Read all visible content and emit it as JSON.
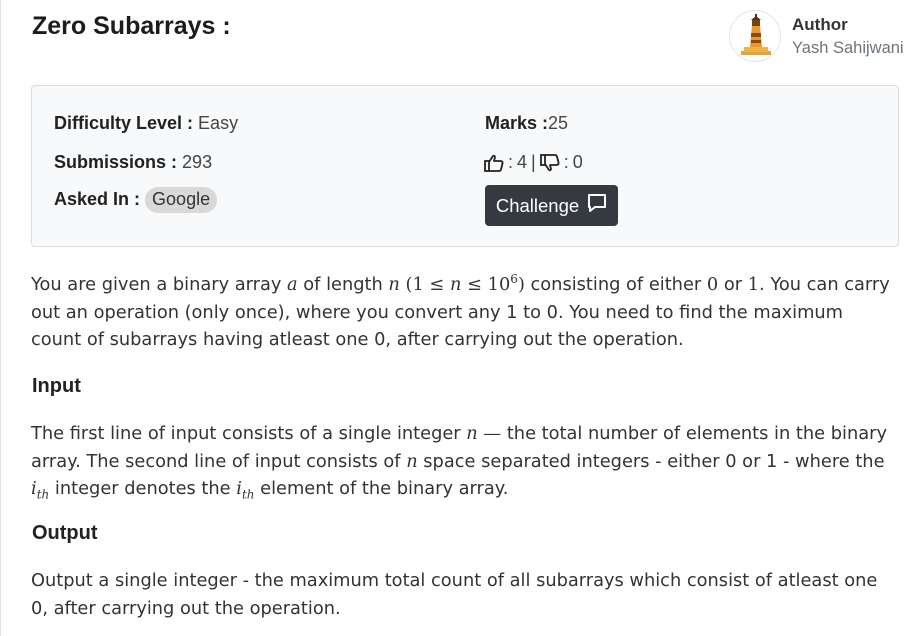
{
  "problem": {
    "title": "Zero Subarrays :"
  },
  "author": {
    "label": "Author",
    "name": "Yash Sahijwani",
    "avatar_icon": "lighthouse-icon"
  },
  "info": {
    "difficulty_label": "Difficulty Level :",
    "difficulty_value": "Easy",
    "submissions_label": "Submissions :",
    "submissions_value": "293",
    "asked_in_label": "Asked In :",
    "asked_in_tag": "Google",
    "marks_label": "Marks :",
    "marks_value": "25",
    "likes": "4",
    "dislikes": "0",
    "challenge_label": "Challenge",
    "challenge_icon": "comment-icon"
  },
  "statement": {
    "p1_a": "You are given a binary array",
    "var_a": "a",
    "p1_b": "of length",
    "var_n": "n",
    "constraint_open": "(1 ≤",
    "constraint_n": "n",
    "constraint_le": "≤ 10",
    "constraint_exp": "6",
    "constraint_close": ")",
    "p1_c": "consisting of either",
    "zero": "0",
    "p1_or": "or",
    "one": "1",
    "p1_d": ". You can carry out an operation (only once), where you convert any 1 to 0. You need to find the maximum count of subarrays having atleast one 0, after carrying out the operation."
  },
  "input": {
    "heading": "Input",
    "t1": "The first line of input consists of a single integer",
    "n1": "n",
    "dash": "—",
    "t2": "the total number of elements in the binary array. The second line of input consists of",
    "n2": "n",
    "t3": "space separated integers - either 0 or 1 - where the",
    "ith": "i",
    "ith_sub": "th",
    "t4": "integer denotes the",
    "ith2": "i",
    "ith2_sub": "th",
    "t5": "element of the binary array."
  },
  "output": {
    "heading": "Output",
    "text": "Output a single integer - the maximum total count of all subarrays which consist of atleast one 0, after carrying out the operation."
  },
  "colors": {
    "button_bg": "#343a40",
    "card_bg": "#f8f9fa",
    "tag_bg": "#d9d9d9"
  }
}
